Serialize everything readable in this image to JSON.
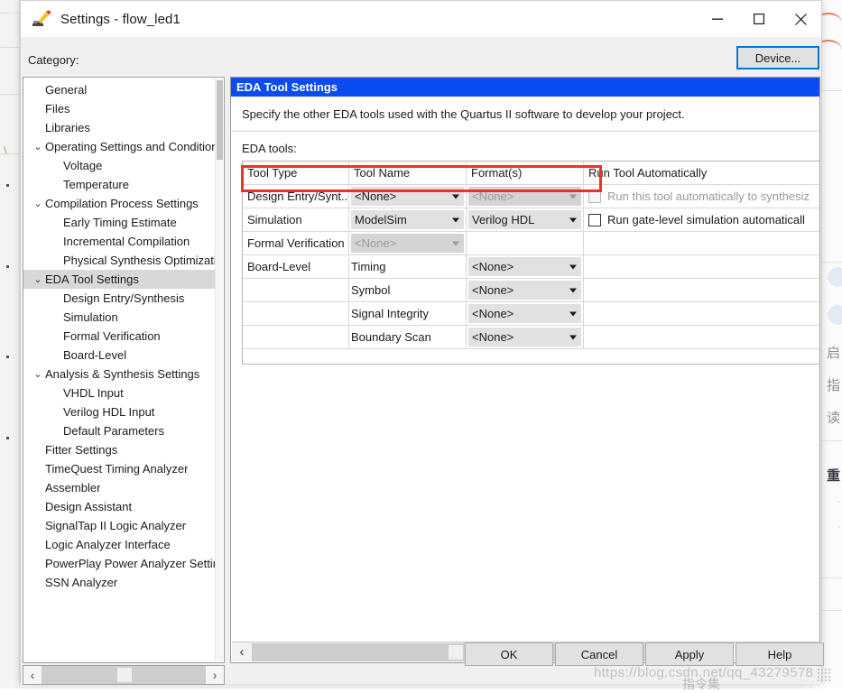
{
  "window": {
    "title": "Settings - flow_led1",
    "icon": "settings-pencil-icon",
    "minimize": "—",
    "maximize": "☐",
    "close": "✕"
  },
  "category": {
    "label": "Category:",
    "device_button": "Device...",
    "items": [
      {
        "label": "General",
        "level": 0,
        "chevron": "",
        "selected": false
      },
      {
        "label": "Files",
        "level": 0,
        "chevron": "",
        "selected": false
      },
      {
        "label": "Libraries",
        "level": 0,
        "chevron": "",
        "selected": false
      },
      {
        "label": "Operating Settings and Conditions",
        "level": 0,
        "chevron": "⌄",
        "selected": false
      },
      {
        "label": "Voltage",
        "level": 1,
        "chevron": "",
        "selected": false
      },
      {
        "label": "Temperature",
        "level": 1,
        "chevron": "",
        "selected": false
      },
      {
        "label": "Compilation Process Settings",
        "level": 0,
        "chevron": "⌄",
        "selected": false
      },
      {
        "label": "Early Timing Estimate",
        "level": 1,
        "chevron": "",
        "selected": false
      },
      {
        "label": "Incremental Compilation",
        "level": 1,
        "chevron": "",
        "selected": false
      },
      {
        "label": "Physical Synthesis Optimization",
        "level": 1,
        "chevron": "",
        "selected": false
      },
      {
        "label": "EDA Tool Settings",
        "level": 0,
        "chevron": "⌄",
        "selected": true
      },
      {
        "label": "Design Entry/Synthesis",
        "level": 1,
        "chevron": "",
        "selected": false
      },
      {
        "label": "Simulation",
        "level": 1,
        "chevron": "",
        "selected": false
      },
      {
        "label": "Formal Verification",
        "level": 1,
        "chevron": "",
        "selected": false
      },
      {
        "label": "Board-Level",
        "level": 1,
        "chevron": "",
        "selected": false
      },
      {
        "label": "Analysis & Synthesis Settings",
        "level": 0,
        "chevron": "⌄",
        "selected": false
      },
      {
        "label": "VHDL Input",
        "level": 1,
        "chevron": "",
        "selected": false
      },
      {
        "label": "Verilog HDL Input",
        "level": 1,
        "chevron": "",
        "selected": false
      },
      {
        "label": "Default Parameters",
        "level": 1,
        "chevron": "",
        "selected": false
      },
      {
        "label": "Fitter Settings",
        "level": 0,
        "chevron": "",
        "selected": false
      },
      {
        "label": "TimeQuest Timing Analyzer",
        "level": 0,
        "chevron": "",
        "selected": false
      },
      {
        "label": "Assembler",
        "level": 0,
        "chevron": "",
        "selected": false
      },
      {
        "label": "Design Assistant",
        "level": 0,
        "chevron": "",
        "selected": false
      },
      {
        "label": "SignalTap II Logic Analyzer",
        "level": 0,
        "chevron": "",
        "selected": false
      },
      {
        "label": "Logic Analyzer Interface",
        "level": 0,
        "chevron": "",
        "selected": false
      },
      {
        "label": "PowerPlay Power Analyzer Settings",
        "level": 0,
        "chevron": "",
        "selected": false
      },
      {
        "label": "SSN Analyzer",
        "level": 0,
        "chevron": "",
        "selected": false
      }
    ],
    "scroll_left_arrow": "‹",
    "scroll_right_arrow": "›"
  },
  "panel": {
    "header": "EDA Tool Settings",
    "description": "Specify the other EDA tools used with the Quartus II software to develop your project.",
    "subtitle": "EDA tools:",
    "columns": [
      "Tool Type",
      "Tool Name",
      "Format(s)",
      "Run Tool Automatically"
    ],
    "rows": [
      {
        "tool_type": "Design Entry/Synt...",
        "tool_name": "<None>",
        "tool_name_state": "enabled",
        "format": "<None>",
        "format_state": "disabled",
        "checkbox": true,
        "checkbox_state": "disabled",
        "checkbox_label": "Run this tool automatically to synthesiz",
        "highlight": false
      },
      {
        "tool_type": "Simulation",
        "tool_name": "ModelSim",
        "tool_name_state": "enabled",
        "format": "Verilog HDL",
        "format_state": "enabled",
        "checkbox": true,
        "checkbox_state": "enabled",
        "checkbox_label": "Run gate-level simulation automaticall",
        "highlight": true
      },
      {
        "tool_type": "Formal Verification",
        "tool_name": "<None>",
        "tool_name_state": "disabled",
        "format": "",
        "format_state": "none",
        "checkbox": false,
        "checkbox_state": "none",
        "checkbox_label": "",
        "highlight": false
      },
      {
        "tool_type": "Board-Level",
        "tool_name": "Timing",
        "tool_name_state": "text",
        "format": "<None>",
        "format_state": "enabled",
        "checkbox": false,
        "checkbox_state": "none",
        "checkbox_label": "",
        "highlight": false
      },
      {
        "tool_type": "",
        "tool_name": "Symbol",
        "tool_name_state": "text",
        "format": "<None>",
        "format_state": "enabled",
        "checkbox": false,
        "checkbox_state": "none",
        "checkbox_label": "",
        "highlight": false
      },
      {
        "tool_type": "",
        "tool_name": "Signal Integrity",
        "tool_name_state": "text",
        "format": "<None>",
        "format_state": "enabled",
        "checkbox": false,
        "checkbox_state": "none",
        "checkbox_label": "",
        "highlight": false
      },
      {
        "tool_type": "",
        "tool_name": "Boundary Scan",
        "tool_name_state": "text",
        "format": "<None>",
        "format_state": "enabled",
        "checkbox": false,
        "checkbox_state": "none",
        "checkbox_label": "",
        "highlight": false
      }
    ],
    "scroll_left_arrow": "‹",
    "scroll_right_arrow": "›"
  },
  "footer": {
    "ok": "OK",
    "cancel": "Cancel",
    "apply": "Apply",
    "help": "Help"
  },
  "watermark": {
    "url": "https://blog.csdn.net/qq_43279578",
    "cjk": "指令集"
  },
  "background": {
    "texts": [
      "启",
      "指",
      "读",
      "重"
    ],
    "tiny": [
      "·",
      "·"
    ]
  },
  "colors": {
    "panel_header_bg": "#0b4cf0",
    "highlight_border": "#ee3124",
    "accent_focus": "#0078d7",
    "selected_row_bg": "#d8d8d8"
  }
}
